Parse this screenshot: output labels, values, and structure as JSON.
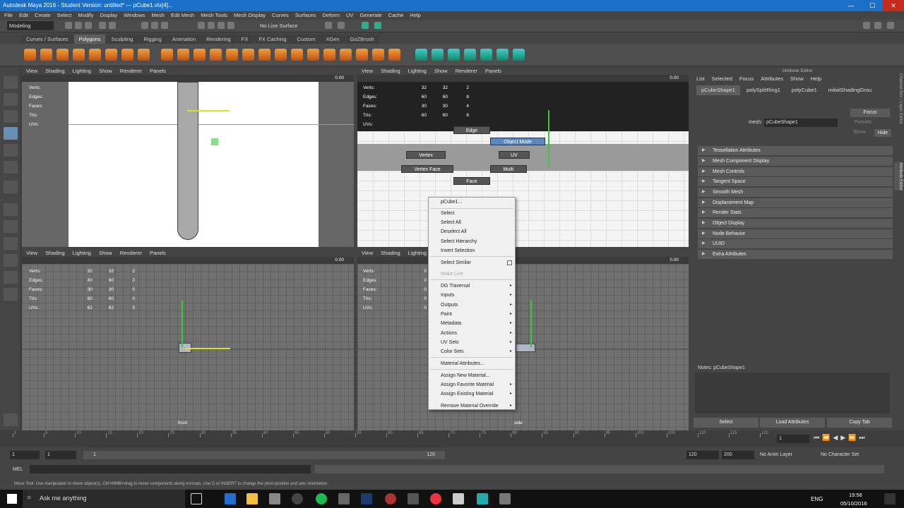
{
  "window": {
    "title": "Autodesk Maya 2016 - Student Version: untitled*   ---   pCube1.vtx[4]...",
    "min": "—",
    "max": "☐",
    "close": "✕"
  },
  "menubar": [
    "File",
    "Edit",
    "Create",
    "Select",
    "Modify",
    "Display",
    "Windows",
    "Mesh",
    "Edit Mesh",
    "Mesh Tools",
    "Mesh Display",
    "Curves",
    "Surfaces",
    "Deform",
    "UV",
    "Generate",
    "Cache",
    "Help"
  ],
  "status": {
    "mode": "Modeling",
    "live_surface": "No Live Surface"
  },
  "shelf_tabs": [
    "Curves / Surfaces",
    "Polygons",
    "Sculpting",
    "Rigging",
    "Animation",
    "Rendering",
    "FX",
    "FX Caching",
    "Custom",
    "XGen",
    "GoZBrush"
  ],
  "shelf_active": "Polygons",
  "viewport_menu": [
    "View",
    "Shading",
    "Lighting",
    "Show",
    "Renderer",
    "Panels"
  ],
  "viewport_value": "0.00",
  "hud_labels": [
    "Verts:",
    "Edges:",
    "Faces:",
    "Tris:",
    "UVs:"
  ],
  "hud_persp": [
    [
      "32",
      "32",
      "2"
    ],
    [
      "60",
      "60",
      "8"
    ],
    [
      "30",
      "30",
      "4"
    ],
    [
      "60",
      "60",
      "8"
    ],
    [
      "",
      "",
      ""
    ]
  ],
  "hud_ortho": [
    [
      "32",
      "32",
      "2"
    ],
    [
      "60",
      "60",
      "0"
    ],
    [
      "30",
      "30",
      "0"
    ],
    [
      "60",
      "60",
      "0"
    ],
    [
      "62",
      "62",
      "0"
    ]
  ],
  "hud_side": [
    [
      "0"
    ],
    [
      "0"
    ],
    [
      "0"
    ],
    [
      "0"
    ],
    [
      "0"
    ]
  ],
  "labels": {
    "front": "front",
    "side": "side"
  },
  "marking_menu": {
    "edge": "Edge",
    "object_mode": "Object Mode",
    "vertex": "Vertex",
    "uv": "UV",
    "vertex_face": "Vertex Face",
    "multi": "Multi",
    "face": "Face"
  },
  "context_menu": {
    "header": "pCube1...",
    "items": [
      {
        "label": "Select",
        "arrow": false
      },
      {
        "label": "Select All",
        "arrow": false
      },
      {
        "label": "Deselect All",
        "arrow": false
      },
      {
        "label": "Select Hierarchy",
        "arrow": false
      },
      {
        "label": "Invert Selection",
        "arrow": false
      },
      {
        "label": "Select Similar",
        "arrow": false,
        "box": true
      },
      {
        "label": "Make Live",
        "arrow": false,
        "disabled": true
      },
      {
        "label": "DG Traversal",
        "arrow": true
      },
      {
        "label": "Inputs",
        "arrow": true
      },
      {
        "label": "Outputs",
        "arrow": true
      },
      {
        "label": "Paint",
        "arrow": true
      },
      {
        "label": "Metadata",
        "arrow": true
      },
      {
        "label": "Actions",
        "arrow": true
      },
      {
        "label": "UV Sets",
        "arrow": true
      },
      {
        "label": "Color Sets",
        "arrow": true
      },
      {
        "label": "Material Attributes...",
        "arrow": false
      },
      {
        "label": "Assign New Material...",
        "arrow": false
      },
      {
        "label": "Assign Favorite Material",
        "arrow": true
      },
      {
        "label": "Assign Existing Material",
        "arrow": true
      },
      {
        "label": "Remove Material Override",
        "arrow": true
      }
    ]
  },
  "attribute_editor": {
    "title": "Attribute Editor",
    "menu": [
      "List",
      "Selected",
      "Focus",
      "Attributes",
      "Show",
      "Help"
    ],
    "tabs": [
      "pCubeShape1",
      "polySplitRing1",
      "polyCube1",
      "initialShadingGrou"
    ],
    "mesh_label": "mesh:",
    "mesh_value": "pCubeShape1",
    "focus": "Focus",
    "presets": "Presets",
    "show": "Show",
    "hide": "Hide",
    "sections": [
      "Tessellation Attributes",
      "Mesh Component Display",
      "Mesh Controls",
      "Tangent Space",
      "Smooth Mesh",
      "Displacement Map",
      "Render Stats",
      "Object Display",
      "Node Behavior",
      "UUID",
      "Extra Attributes"
    ],
    "notes": "Notes:  pCubeShape1",
    "buttons": [
      "Select",
      "Load Attributes",
      "Copy Tab"
    ],
    "side_tabs": [
      "Channel Box / Layer Editor",
      "Attribute Editor"
    ]
  },
  "timeline": {
    "ticks": [
      "1",
      "5",
      "10",
      "15",
      "20",
      "25",
      "30",
      "35",
      "40",
      "45",
      "50",
      "55",
      "60",
      "65",
      "70",
      "75",
      "80",
      "85",
      "90",
      "95",
      "100",
      "105",
      "110",
      "115",
      "120"
    ],
    "current": "1"
  },
  "range": {
    "start": "1",
    "start2": "1",
    "slider_start": "1",
    "slider_end": "120",
    "end": "120",
    "end2": "200",
    "anim_layer": "No Anim Layer",
    "char_set": "No Character Set"
  },
  "mel": "MEL",
  "help_line": "Move Tool: Use manipulator to move object(s). Ctrl+MMB+drag to move components along normals. Use D or INSERT to change the pivot position and axis orientation.",
  "taskbar": {
    "search": "Ask me anything",
    "lang": "ENG",
    "time": "19:56",
    "date": "05/10/2016"
  }
}
